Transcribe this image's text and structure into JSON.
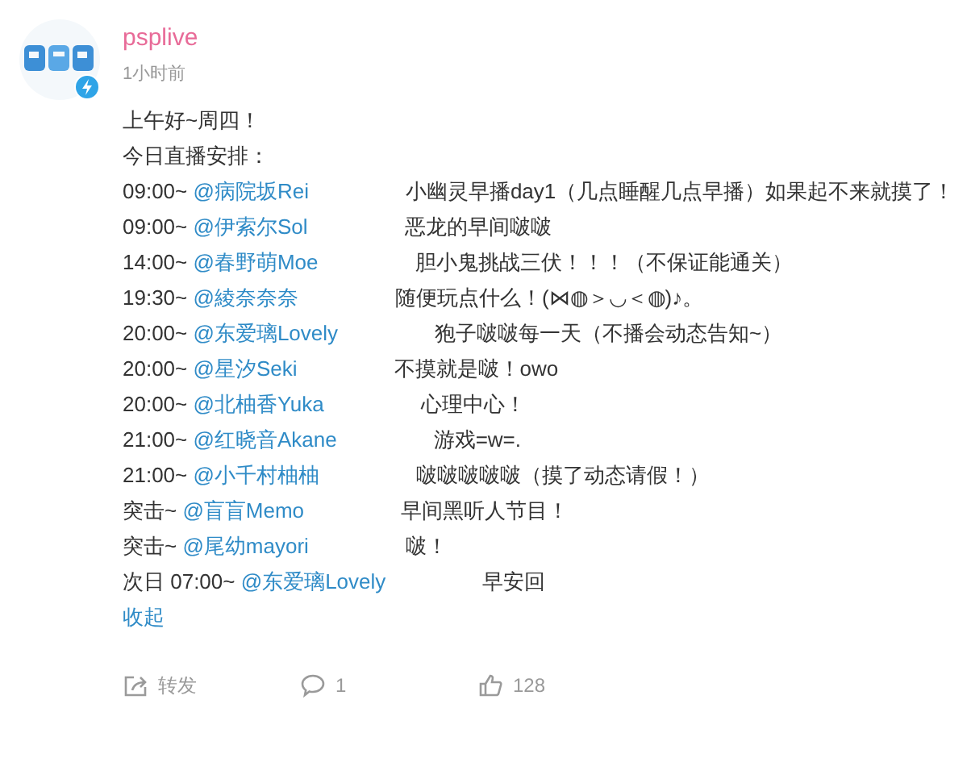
{
  "post": {
    "author": "psplive",
    "time": "1小时前",
    "intro": [
      "上午好~周四！",
      "今日直播安排："
    ],
    "schedule": [
      {
        "time": "09:00~",
        "mention": "@病院坂Rei",
        "text": "小幽灵早播day1（几点睡醒几点早播）如果起不来就摸了！"
      },
      {
        "time": "09:00~",
        "mention": "@伊索尔Sol",
        "text": "恶龙的早间啵啵"
      },
      {
        "time": "14:00~",
        "mention": "@春野萌Moe",
        "text": "胆小鬼挑战三伏！！！（不保证能通关）"
      },
      {
        "time": "19:30~",
        "mention": "@綾奈奈奈",
        "text": "随便玩点什么！(⋈◍＞◡＜◍)♪。"
      },
      {
        "time": "20:00~",
        "mention": "@东爱璃Lovely",
        "text": "狍子啵啵每一天（不播会动态告知~）"
      },
      {
        "time": "20:00~",
        "mention": "@星汐Seki",
        "text": "不摸就是啵！owo"
      },
      {
        "time": "20:00~",
        "mention": "@北柚香Yuka",
        "text": "心理中心！"
      },
      {
        "time": "21:00~",
        "mention": "@红晓音Akane",
        "text": "游戏=w=."
      },
      {
        "time": "21:00~",
        "mention": "@小千村柚柚",
        "text": "啵啵啵啵啵（摸了动态请假！）"
      },
      {
        "time": "突击~",
        "mention": "@盲盲Memo",
        "text": "早间黑听人节目！"
      },
      {
        "time": "突击~",
        "mention": "@尾幼mayori",
        "text": "啵！"
      },
      {
        "time": "次日 07:00~",
        "mention": "@东爱璃Lovely",
        "text": "早安回"
      }
    ],
    "collapse": "收起",
    "actions": [
      {
        "kind": "repost",
        "label": "转发"
      },
      {
        "kind": "comment",
        "label": "1"
      },
      {
        "kind": "like",
        "label": "128"
      }
    ]
  }
}
